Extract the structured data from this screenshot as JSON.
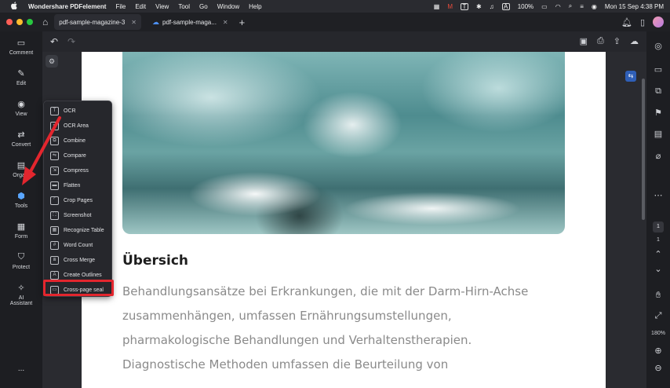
{
  "menubar": {
    "app_name": "Wondershare PDFelement",
    "items": [
      "File",
      "Edit",
      "View",
      "Tool",
      "Go",
      "Window",
      "Help"
    ],
    "battery": "100%",
    "datetime": "Mon 15 Sep  4:38 PM"
  },
  "tabs": [
    {
      "label": "pdf-sample-magazine-3",
      "active": true
    },
    {
      "label": "pdf-sample-maga...",
      "active": false
    }
  ],
  "left_sidebar": [
    {
      "label": "Comment",
      "icon": "comment-icon"
    },
    {
      "label": "Edit",
      "icon": "edit-icon"
    },
    {
      "label": "View",
      "icon": "view-icon"
    },
    {
      "label": "Convert",
      "icon": "convert-icon"
    },
    {
      "label": "Orga...",
      "icon": "organize-icon"
    },
    {
      "label": "Tools",
      "icon": "tools-icon",
      "active": true
    },
    {
      "label": "Form",
      "icon": "form-icon"
    },
    {
      "label": "Protect",
      "icon": "protect-icon"
    },
    {
      "label": "AI",
      "label2": "Assistant",
      "icon": "ai-assistant-icon"
    },
    {
      "label": "...",
      "icon": "more-icon"
    }
  ],
  "tools_menu": [
    "OCR",
    "OCR Area",
    "Combine",
    "Compare",
    "Compress",
    "Flatten",
    "Crop Pages",
    "Screenshot",
    "Recognize Table",
    "Word Count",
    "Cross Merge",
    "Create Outlines",
    "Cross-page seal"
  ],
  "document": {
    "heading": "Übersich",
    "paragraph_lines": [
      "Behandlungsansätze bei Erkrankungen, die mit der Darm-Hirn-Achse",
      "zusammenhängen, umfassen Ernährungsumstellungen,",
      "pharmakologische Behandlungen und Verhaltenstherapien.",
      "Diagnostische Methoden umfassen die Beurteilung von"
    ]
  },
  "right_sidebar": {
    "page_current": "1",
    "page_total": "1",
    "zoom": "180%"
  },
  "colors": {
    "highlight": "#e3262e",
    "accent": "#5aa6ff"
  }
}
